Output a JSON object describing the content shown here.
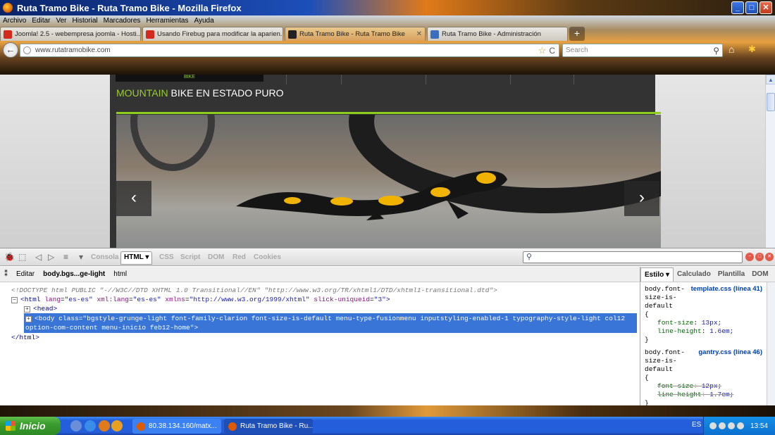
{
  "window": {
    "title": "Ruta Tramo Bike - Ruta Tramo Bike - Mozilla Firefox",
    "buttons": {
      "minimize": "_",
      "maximize": "□",
      "close": "✕"
    }
  },
  "menubar": [
    "Archivo",
    "Editar",
    "Ver",
    "Historial",
    "Marcadores",
    "Herramientas",
    "Ayuda"
  ],
  "tabs": [
    {
      "label": "Joomla! 2.5 - webempresa joomla - Hosti...",
      "color": "#d42a1e"
    },
    {
      "label": "Usando Firebug para modificar la aparien...",
      "color": "#d42a1e"
    },
    {
      "label": "Ruta Tramo Bike - Ruta Tramo Bike",
      "color": "#222222",
      "active": true,
      "close": "✕"
    },
    {
      "label": "Ruta Tramo Bike - Administración",
      "color": "#3a6fc0"
    }
  ],
  "newtab": "+",
  "navbar": {
    "back": "←",
    "url": "www.rutatramobike.com",
    "star": "☆",
    "reload": "C",
    "search_placeholder": "Search",
    "search_icon": "⚲",
    "home": "⌂",
    "addon": "✱"
  },
  "site": {
    "logo_text": "BIKE",
    "tagline_hl": "MOUNTAIN",
    "tagline_rest": " BIKE EN ESTADO PURO",
    "prev": "‹",
    "next": "›",
    "accent": "#8ccf1a"
  },
  "scrollbar": {
    "up": "▲",
    "down": "▼"
  },
  "firebug": {
    "tabs": [
      "Consola",
      "HTML ▾",
      "CSS",
      "Script",
      "DOM",
      "Red",
      "Cookies"
    ],
    "active_tab": "HTML ▾",
    "breadcrumb": {
      "edit": "Editar",
      "current": "body.bgs...ge-light",
      "parent": "html"
    },
    "html": {
      "doctype": "<!DOCTYPE html PUBLIC \"-//W3C//DTD XHTML 1.0 Transitional//EN\" \"http://www.w3.org/TR/xhtml1/DTD/xhtml1-transitional.dtd\">",
      "html_open_tag": "<html",
      "html_attrs": [
        {
          "name": "lang",
          "value": "\"es-es\""
        },
        {
          "name": "xml:lang",
          "value": "\"es-es\""
        },
        {
          "name": "xmlns",
          "value": "\"http://www.w3.org/1999/xhtml\""
        },
        {
          "name": "slick-uniqueid",
          "value": "\"3\""
        }
      ],
      "head": "<head>",
      "body_open": "<body",
      "body_class_attr": "class",
      "body_class": "\"bgstyle-grunge-light font-family-clarion font-size-is-default menu-type-fusionmenu inputstyling-enabled-1 typography-style-light col12 option-com-content menu-inicio feb12-home\"",
      "body_close": ">",
      "html_close": "</html>"
    },
    "side_tabs": [
      "Estilo ▾",
      "Calculado",
      "Plantilla",
      "DOM"
    ],
    "rules": [
      {
        "selector": "body.font-\nsize-is-\ndefault",
        "source": "template.css (línea 41)",
        "props": [
          {
            "name": "font-size",
            "value": "13px;",
            "overridden": false
          },
          {
            "name": "line-height",
            "value": "1.6em;",
            "overridden": false
          }
        ]
      },
      {
        "selector": "body.font-\nsize-is-\ndefault",
        "source": "gantry.css (línea 46)",
        "props": [
          {
            "name": "font-size",
            "value": "12px;",
            "overridden": true
          },
          {
            "name": "line-height",
            "value": "1.7em;",
            "overridden": true
          }
        ]
      }
    ],
    "brace_open": "{",
    "brace_close": "}"
  },
  "taskbar": {
    "start": "Inicio",
    "tasks": [
      {
        "label": "80.38.134.160/matx...",
        "icon_color": "#e05a00"
      },
      {
        "label": "Ruta Tramo Bike - Ru...",
        "icon_color": "#e05a00",
        "active": true
      }
    ],
    "lang": "ES",
    "clock": "13:54"
  }
}
